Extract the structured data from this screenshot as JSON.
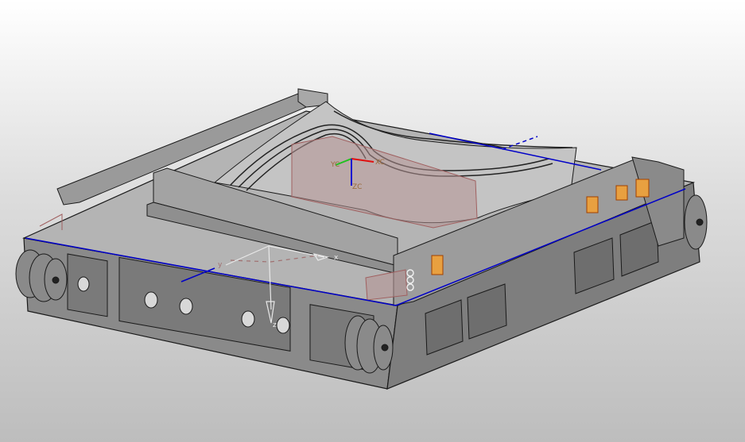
{
  "viewport": {
    "background_top": "#ffffff",
    "background_bottom": "#bdbdbd",
    "model_color": "#8c8c8c",
    "edge_color": "#1a1a1a",
    "datum_line_color": "#0000c8",
    "plane_color": "#b49494"
  },
  "wcs": {
    "x_label": "XC",
    "y_label": "YC",
    "z_label": "ZC",
    "x_color": "#e01010",
    "y_color": "#20c020",
    "z_color": "#1010d0"
  },
  "datum_csys": {
    "x_label": "x",
    "y_label": "y",
    "z_label": "z"
  }
}
